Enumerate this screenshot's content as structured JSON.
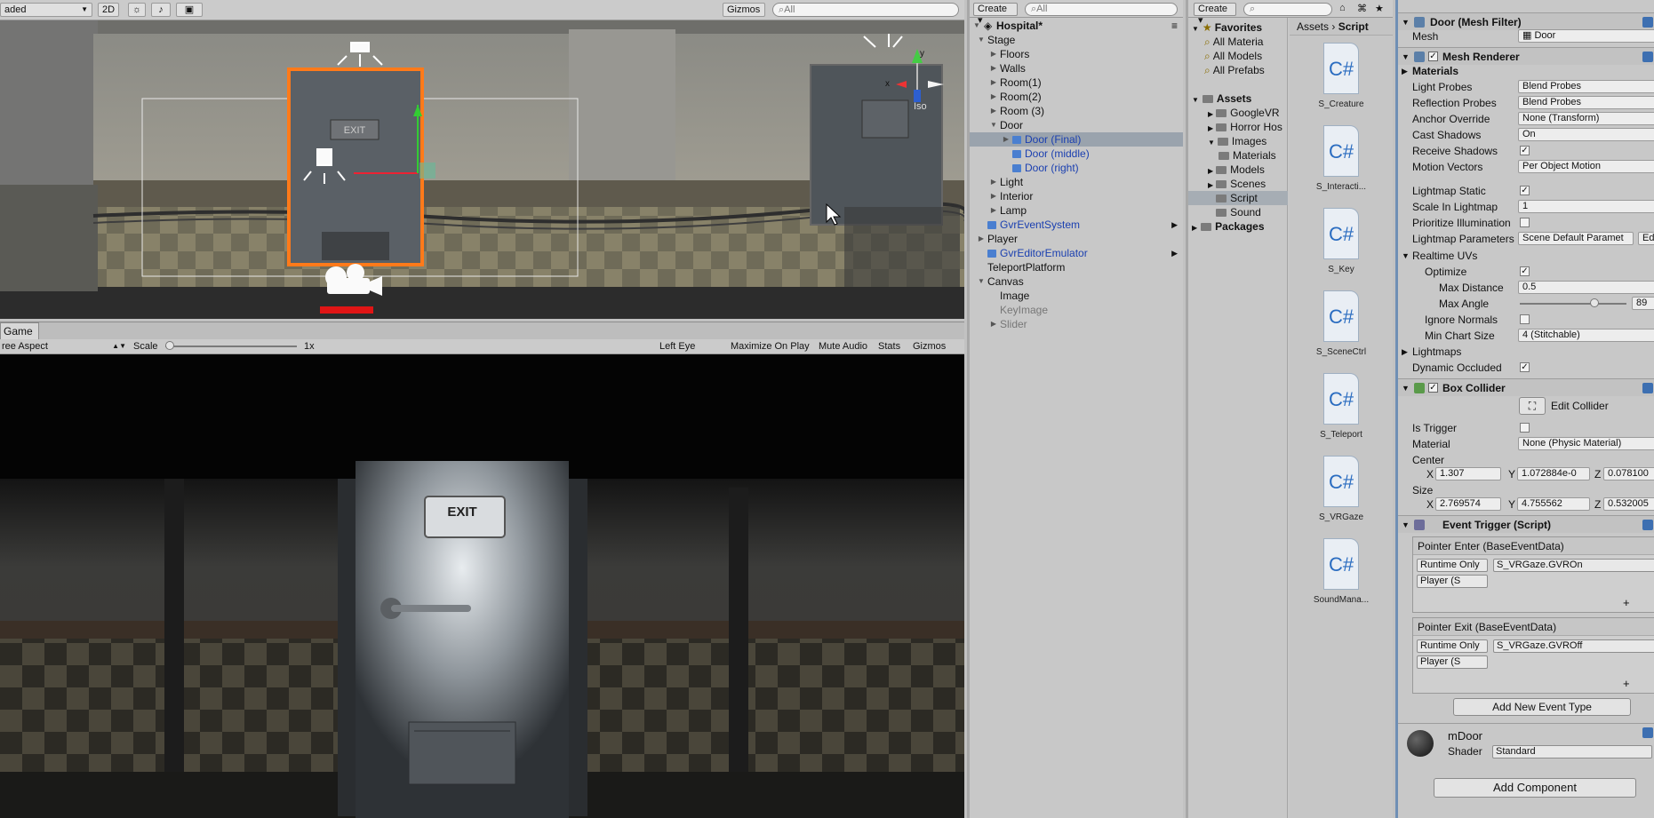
{
  "scene": {
    "shading_mode": "aded",
    "mode_2d": "2D",
    "gizmos_label": "Gizmos",
    "search_placeholder": "All",
    "exit_sign": "EXIT",
    "iso_label": "Iso",
    "axis_y": "y",
    "axis_x": "x"
  },
  "game": {
    "tab_label": "Game",
    "aspect": "ree Aspect",
    "scale_label": "Scale",
    "scale_value": "1x",
    "eye": "Left Eye",
    "maximize": "Maximize On Play",
    "mute": "Mute Audio",
    "stats": "Stats",
    "gizmos": "Gizmos",
    "exit_sign": "EXIT"
  },
  "hierarchy": {
    "create_label": "Create",
    "search_placeholder": "All",
    "root": "Hospital*",
    "items": [
      {
        "label": "Stage",
        "depth": 1,
        "arrow": "open"
      },
      {
        "label": "Floors",
        "depth": 2,
        "arrow": "closed"
      },
      {
        "label": "Walls",
        "depth": 2,
        "arrow": "closed"
      },
      {
        "label": "Room(1)",
        "depth": 2,
        "arrow": "closed"
      },
      {
        "label": "Room(2)",
        "depth": 2,
        "arrow": "closed"
      },
      {
        "label": "Room (3)",
        "depth": 2,
        "arrow": "closed"
      },
      {
        "label": "Door",
        "depth": 2,
        "arrow": "open"
      },
      {
        "label": "Door (Final)",
        "depth": 3,
        "arrow": "closed",
        "style": "blue",
        "selected": true
      },
      {
        "label": "Door (middle)",
        "depth": 3,
        "arrow": "none",
        "style": "blue"
      },
      {
        "label": "Door (right)",
        "depth": 3,
        "arrow": "none",
        "style": "blue"
      },
      {
        "label": "Light",
        "depth": 2,
        "arrow": "closed"
      },
      {
        "label": "Interior",
        "depth": 2,
        "arrow": "closed"
      },
      {
        "label": "Lamp",
        "depth": 2,
        "arrow": "closed"
      },
      {
        "label": "GvrEventSystem",
        "depth": 1,
        "arrow": "none",
        "style": "blue",
        "more": true
      },
      {
        "label": "Player",
        "depth": 1,
        "arrow": "closed"
      },
      {
        "label": "GvrEditorEmulator",
        "depth": 1,
        "arrow": "none",
        "style": "blue",
        "more": true
      },
      {
        "label": "TeleportPlatform",
        "depth": 1,
        "arrow": "none"
      },
      {
        "label": "Canvas",
        "depth": 1,
        "arrow": "open"
      },
      {
        "label": "Image",
        "depth": 2,
        "arrow": "none"
      },
      {
        "label": "KeyImage",
        "depth": 2,
        "arrow": "none",
        "style": "dim"
      },
      {
        "label": "Slider",
        "depth": 2,
        "arrow": "closed",
        "style": "dim"
      }
    ]
  },
  "project": {
    "create_label": "Create",
    "tree": [
      {
        "label": "Favorites",
        "type": "favhead"
      },
      {
        "label": "All Materia",
        "type": "fav"
      },
      {
        "label": "All Models",
        "type": "fav"
      },
      {
        "label": "All Prefabs",
        "type": "fav"
      },
      {
        "label": "",
        "type": "gap"
      },
      {
        "label": "Assets",
        "type": "head"
      },
      {
        "label": "GoogleVR",
        "type": "folder",
        "depth": 1
      },
      {
        "label": "Horror Hos",
        "type": "folder",
        "depth": 1
      },
      {
        "label": "Images",
        "type": "folder",
        "depth": 1,
        "open": true
      },
      {
        "label": "Materials",
        "type": "folder",
        "depth": 2
      },
      {
        "label": "Models",
        "type": "folder",
        "depth": 1
      },
      {
        "label": "Scenes",
        "type": "folder",
        "depth": 1
      },
      {
        "label": "Script",
        "type": "folder",
        "depth": 1,
        "selected": true
      },
      {
        "label": "Sound",
        "type": "folder",
        "depth": 1
      },
      {
        "label": "Packages",
        "type": "head"
      }
    ],
    "breadcrumb": [
      "Assets",
      "Script"
    ],
    "csharp_glyph": "C#",
    "assets": [
      "S_Creature",
      "S_Interacti...",
      "S_Key",
      "S_SceneCtrl",
      "S_Teleport",
      "S_VRGaze",
      "SoundMana..."
    ]
  },
  "inspector": {
    "mesh_filter": {
      "title": "Door (Mesh Filter)",
      "mesh_label": "Mesh",
      "mesh_value": "Door"
    },
    "mesh_renderer": {
      "title": "Mesh Renderer",
      "materials_label": "Materials",
      "rows": [
        {
          "label": "Light Probes",
          "value": "Blend Probes"
        },
        {
          "label": "Reflection Probes",
          "value": "Blend Probes"
        },
        {
          "label": "Anchor Override",
          "value": "None (Transform)"
        },
        {
          "label": "Cast Shadows",
          "value": "On"
        },
        {
          "label": "Receive Shadows",
          "check": "✓"
        },
        {
          "label": "Motion Vectors",
          "value": "Per Object Motion"
        }
      ],
      "rows2": [
        {
          "label": "Lightmap Static",
          "check": "✓"
        },
        {
          "label": "Scale In Lightmap",
          "value": "1"
        },
        {
          "label": "Prioritize Illumination",
          "check": ""
        },
        {
          "label": "Lightmap Parameters",
          "value": "Scene Default Paramet",
          "extra": "Edi"
        }
      ],
      "realtime_uvs": "Realtime UVs",
      "optimize": {
        "label": "Optimize",
        "check": "✓"
      },
      "max_distance": {
        "label": "Max Distance",
        "value": "0.5"
      },
      "max_angle": {
        "label": "Max Angle",
        "value": "89",
        "fraction": 0.99
      },
      "ignore_normals": {
        "label": "Ignore Normals",
        "check": ""
      },
      "min_chart": {
        "label": "Min Chart Size",
        "value": "4 (Stitchable)"
      },
      "lightmaps": "Lightmaps",
      "dynamic_occluded": {
        "label": "Dynamic Occluded",
        "check": "✓"
      }
    },
    "box_collider": {
      "title": "Box Collider",
      "edit_collider": "Edit Collider",
      "is_trigger": "Is Trigger",
      "material_label": "Material",
      "material_value": "None (Physic Material)",
      "center_label": "Center",
      "center": {
        "x": "1.307",
        "y": "1.072884e-0",
        "z": "0.078100"
      },
      "size_label": "Size",
      "size": {
        "x": "2.769574",
        "y": "4.755562",
        "z": "0.532005"
      },
      "x": "X",
      "y": "Y",
      "z": "Z"
    },
    "event_trigger": {
      "title": "Event Trigger (Script)",
      "events": [
        {
          "title": "Pointer Enter (BaseEventData)",
          "runtime": "Runtime Only",
          "function": "S_VRGaze.GVROn",
          "target": "Player (S"
        },
        {
          "title": "Pointer Exit (BaseEventData)",
          "runtime": "Runtime Only",
          "function": "S_VRGaze.GVROff",
          "target": "Player (S"
        }
      ],
      "plus": "+",
      "add_event": "Add New Event Type"
    },
    "material": {
      "name": "mDoor",
      "shader_label": "Shader",
      "shader_value": "Standard"
    },
    "add_component": "Add Component"
  }
}
